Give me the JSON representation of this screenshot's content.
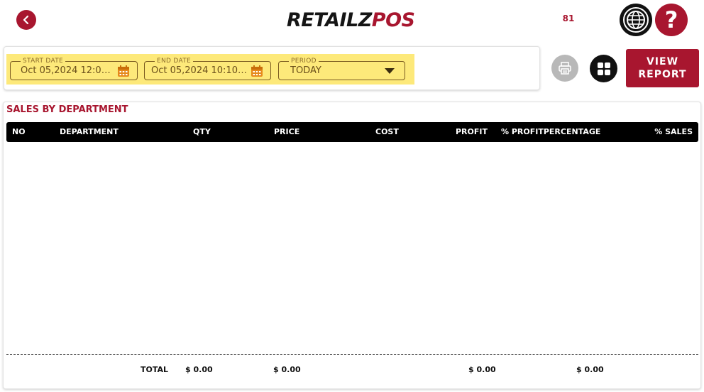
{
  "header": {
    "logo_part1": "RETAILZ",
    "logo_part2": "POS",
    "counter": "81"
  },
  "filters": {
    "start_date": {
      "label": "START DATE",
      "value": "Oct 05,2024 12:00..."
    },
    "end_date": {
      "label": "END DATE",
      "value": "Oct 05,2024 10:10 A..."
    },
    "period": {
      "label": "PERIOD",
      "value": "TODAY"
    }
  },
  "actions": {
    "view_report_line1": "VIEW",
    "view_report_line2": "REPORT"
  },
  "report": {
    "title": "SALES BY DEPARTMENT",
    "columns": [
      "NO",
      "DEPARTMENT",
      "QTY",
      "PRICE",
      "COST",
      "PROFIT",
      "% PROFITPERCENTAGE",
      "% SALES"
    ],
    "rows": [],
    "totals": {
      "label": "TOTAL",
      "qty": "$ 0.00",
      "price": "$ 0.00",
      "profit": "$ 0.00",
      "profit_pct": "$ 0.00"
    }
  },
  "colors": {
    "brand": "#a8162f",
    "highlight": "#fde97a",
    "header_bg": "#000000"
  }
}
